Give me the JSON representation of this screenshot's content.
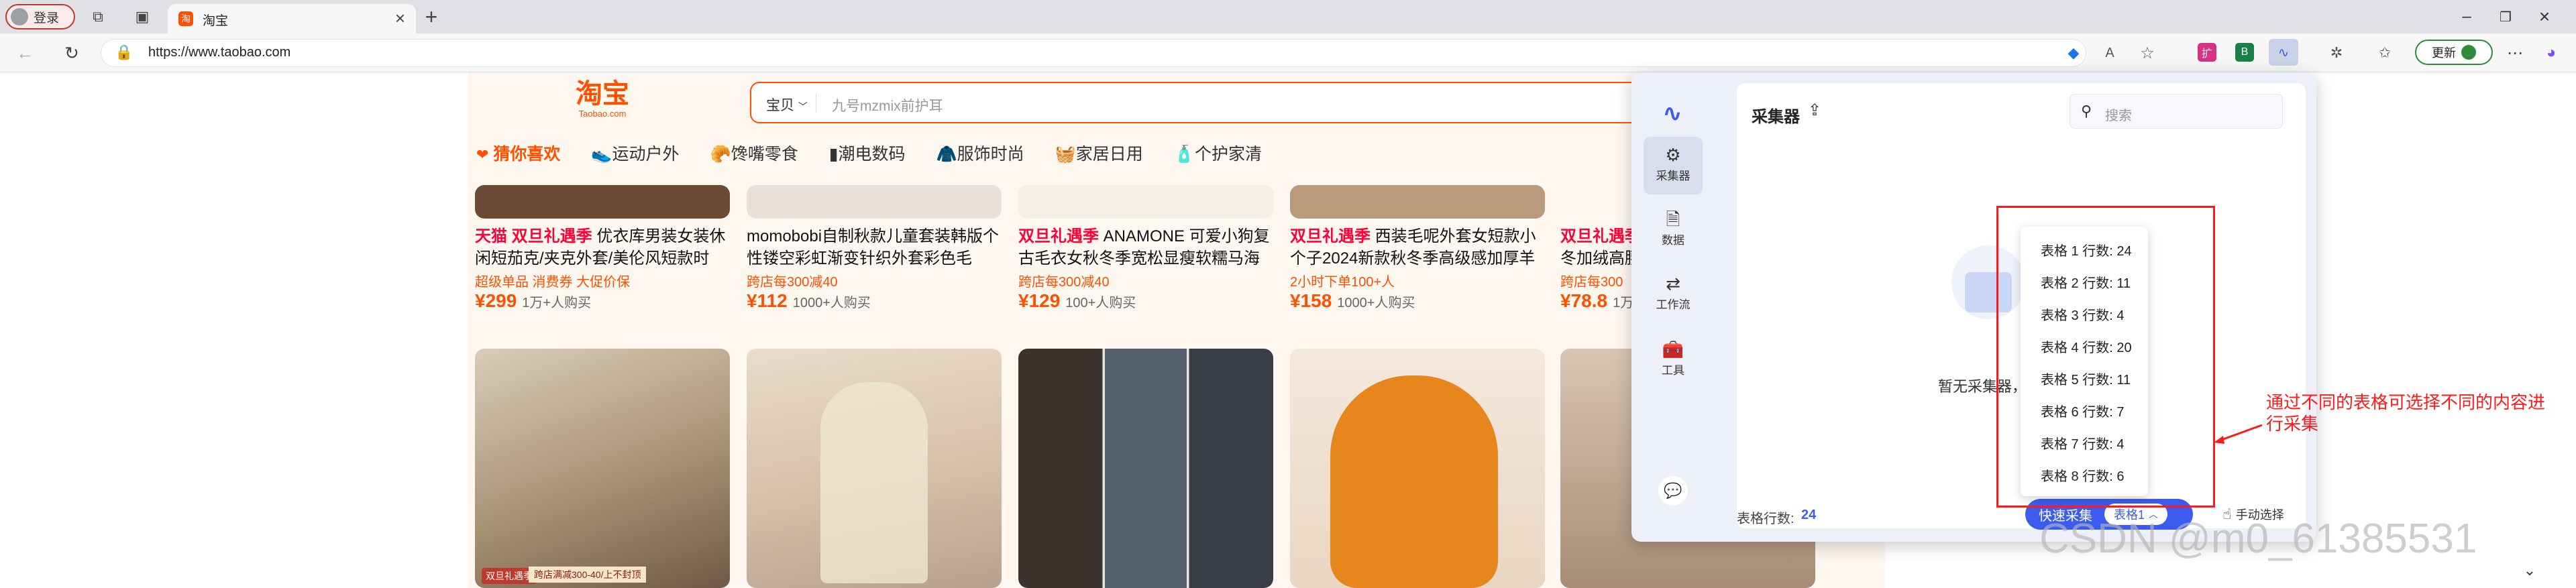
{
  "browser": {
    "profile_label": "登录",
    "tab_title": "淘宝",
    "url": "https://www.taobao.com",
    "update_label": "更新"
  },
  "taobao": {
    "logo_text": "淘宝",
    "logo_sub": "Taobao.com",
    "search_scope": "宝贝",
    "search_placeholder": "九号mzmix前护耳",
    "categories": [
      "猜你喜欢",
      "运动户外",
      "馋嘴零食",
      "潮电数码",
      "服饰时尚",
      "家居日用",
      "个护家清"
    ],
    "products": [
      {
        "tag": "天猫 双旦礼遇季",
        "title": " 优衣库男装女装休闲短茄克/夹克外套/美伦风短款时",
        "sub": "超级单品  消费券  大促价保",
        "price": "¥299",
        "sold": "1万+人购买"
      },
      {
        "tag": "",
        "title": "momobobi自制秋款儿童套装韩版个性镂空彩虹渐变针织外套彩色毛",
        "sub": "跨店每300减40",
        "price": "¥112",
        "sold": "1000+人购买"
      },
      {
        "tag": "双旦礼遇季",
        "title": " ANAMONE 可爱小狗复古毛衣女秋冬季宽松显瘦软糯马海",
        "sub": "跨店每300减40",
        "price": "¥129",
        "sold": "100+人购买"
      },
      {
        "tag": "双旦礼遇季",
        "title": " 西装毛呢外套女短款小个子2024新款秋冬季高级感加厚羊",
        "sub": "2小时下单100+人",
        "price": "¥158",
        "sold": "1000+人购买"
      },
      {
        "tag": "双旦礼遇季",
        "title": " 冬加绒高腰",
        "sub": "跨店每300",
        "price": "¥78.8",
        "sold": "1万"
      }
    ],
    "image_promo": "跨店满减300-40/上不封顶",
    "image_stamp": "双旦礼遇季"
  },
  "collector": {
    "title": "采集器",
    "search_placeholder": "搜索",
    "nav": [
      {
        "label": "采集器"
      },
      {
        "label": "数据"
      },
      {
        "label": "工作流"
      },
      {
        "label": "工具"
      }
    ],
    "empty_text": "暂无采集器，",
    "table_rows_label": "表格行数:",
    "table_rows_value": "24",
    "quick_collect": "快速采集",
    "table_select": "表格1",
    "manual_select": "手动选择",
    "dropdown": [
      "表格 1 行数: 24",
      "表格 2 行数: 11",
      "表格 3 行数: 4",
      "表格 4 行数: 20",
      "表格 5 行数: 11",
      "表格 6 行数: 7",
      "表格 7 行数: 4",
      "表格 8 行数: 6"
    ]
  },
  "annotation": {
    "text": "通过不同的表格可选择不同的内容进行采集",
    "color": "#ff1a1a"
  },
  "watermark": "CSDN @m0_61385531",
  "colors": {
    "taobao_orange": "#ff5000",
    "accent_blue": "#3c5cf0"
  }
}
